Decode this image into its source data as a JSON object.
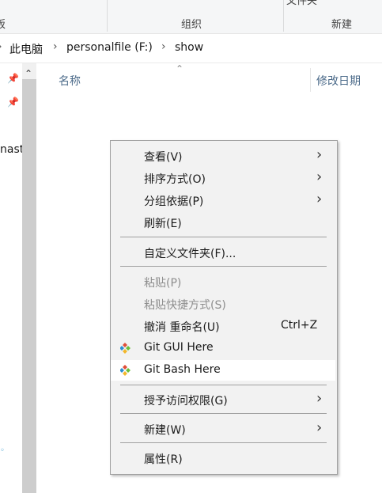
{
  "ribbon": {
    "group1_label": "组织",
    "group2_label": "新建",
    "partial_top": "文件夹",
    "left_partial": "板"
  },
  "address": {
    "this_pc": "此电脑",
    "drive": "personalfile (F:)",
    "folder": "show"
  },
  "nav": {
    "partial_item": "nast"
  },
  "columns": {
    "name": "名称",
    "modified": "修改日期"
  },
  "menu": {
    "items": [
      {
        "label": "查看(V)",
        "submenu": true
      },
      {
        "label": "排序方式(O)",
        "submenu": true
      },
      {
        "label": "分组依据(P)",
        "submenu": true
      },
      {
        "label": "刷新(E)"
      },
      {
        "label": "自定义文件夹(F)..."
      },
      {
        "label": "粘贴(P)",
        "disabled": true
      },
      {
        "label": "粘贴快捷方式(S)",
        "disabled": true
      },
      {
        "label": "撤消 重命名(U)",
        "shortcut": "Ctrl+Z"
      },
      {
        "label": "Git GUI Here",
        "icon": "git-icon"
      },
      {
        "label": "Git Bash Here",
        "icon": "git-icon",
        "highlighted": true
      },
      {
        "label": "授予访问权限(G)",
        "submenu": true
      },
      {
        "label": "新建(W)",
        "submenu": true
      },
      {
        "label": "属性(R)"
      }
    ]
  },
  "colors": {
    "menu_bg": "#f2f2f2",
    "header_text": "#4c6b8a",
    "git_red": "#e04e39",
    "git_blue": "#2d8ed0",
    "git_green": "#6cbf3a",
    "git_yellow": "#f2b72c"
  }
}
